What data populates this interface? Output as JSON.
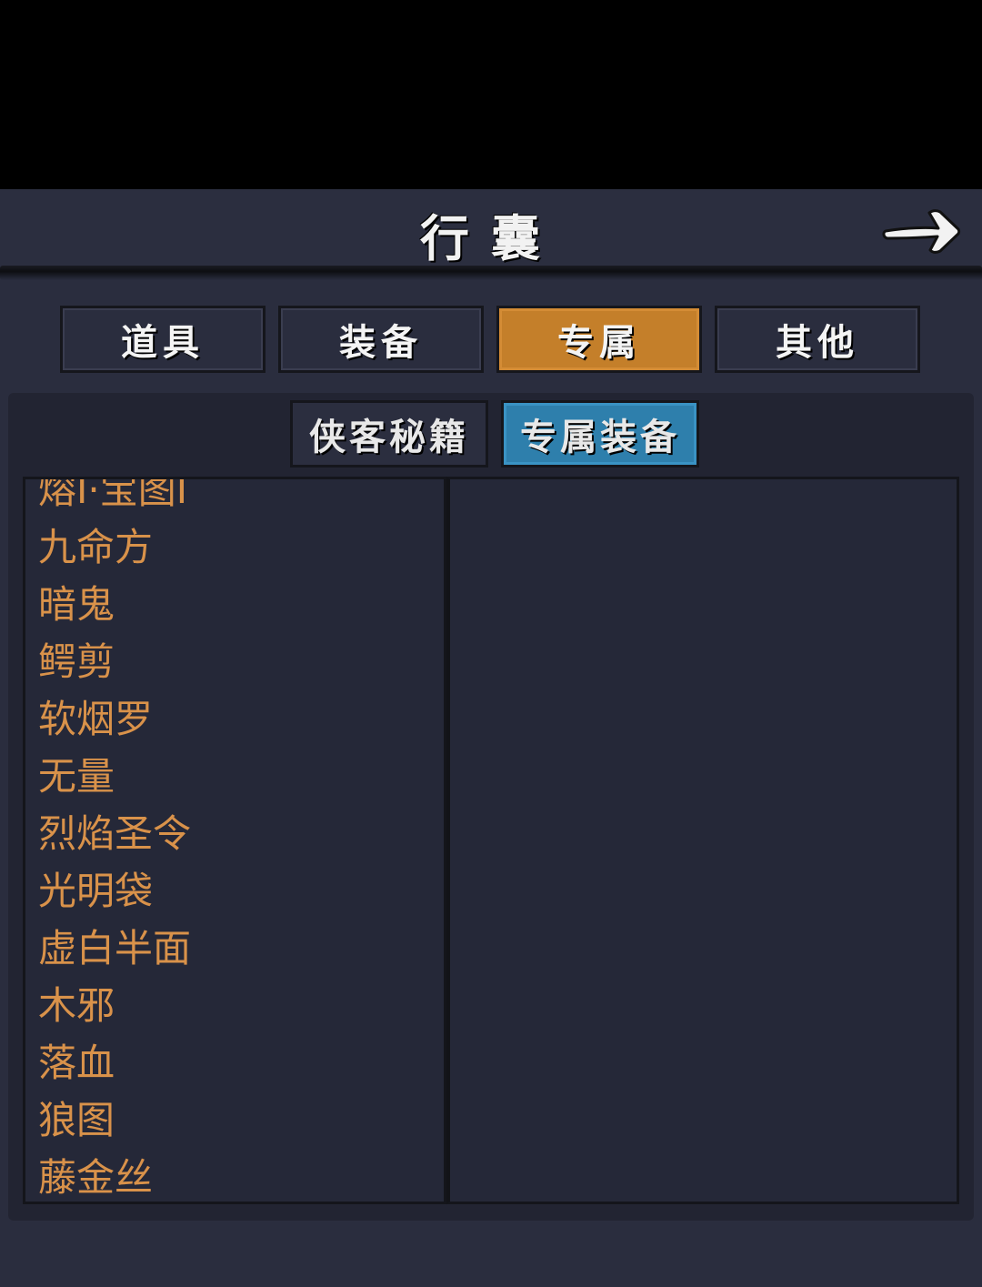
{
  "header": {
    "title": "行囊"
  },
  "tabs": [
    {
      "label": "道具",
      "active": false
    },
    {
      "label": "装备",
      "active": false
    },
    {
      "label": "专属",
      "active": true
    },
    {
      "label": "其他",
      "active": false
    }
  ],
  "subtabs": [
    {
      "label": "侠客秘籍",
      "active": false
    },
    {
      "label": "专属装备",
      "active": true
    }
  ],
  "items": [
    "熔Ⅰ·宝图Ⅰ",
    "九命方",
    "暗鬼",
    "鳄剪",
    "软烟罗",
    "无量",
    "烈焰圣令",
    "光明袋",
    "虚白半面",
    "木邪",
    "落血",
    "狼图",
    "藤金丝"
  ],
  "colors": {
    "active_tab": "#c47f2a",
    "active_subtab": "#2e7fac",
    "item_text": "#d9924a"
  }
}
